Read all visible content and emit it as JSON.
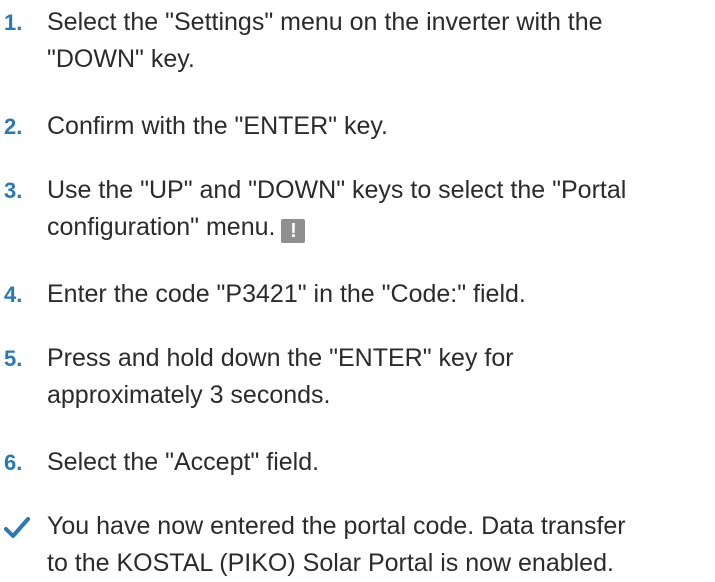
{
  "steps": [
    {
      "number": "1.",
      "text_line1": "Select the \"Settings\" menu on the inverter with the",
      "text_line2": "\"DOWN\" key."
    },
    {
      "number": "2.",
      "text_line1": "Confirm with the \"ENTER\" key."
    },
    {
      "number": "3.",
      "text_line1": "Use the \"UP\" and \"DOWN\" keys to select the \"Portal",
      "text_line2": "configuration\" menu.",
      "icon": "warning-icon",
      "icon_glyph": "!"
    },
    {
      "number": "4.",
      "text_line1": "Enter the code \"P3421\" in the \"Code:\" field."
    },
    {
      "number": "5.",
      "text_line1": "Press and hold down the \"ENTER\" key for",
      "text_line2": "approximately 3 seconds."
    },
    {
      "number": "6.",
      "text_line1": "Select the \"Accept\" field."
    }
  ],
  "result": {
    "icon": "checkmark-icon",
    "text_line1": "You have now entered the portal code. Data transfer",
    "text_line2": "to the KOSTAL (PIKO) Solar Portal is now enabled."
  },
  "colors": {
    "number": "#2a78b4",
    "text": "#2b2b2b",
    "check": "#2a78b4",
    "warning_box": "#8f8f8f"
  }
}
